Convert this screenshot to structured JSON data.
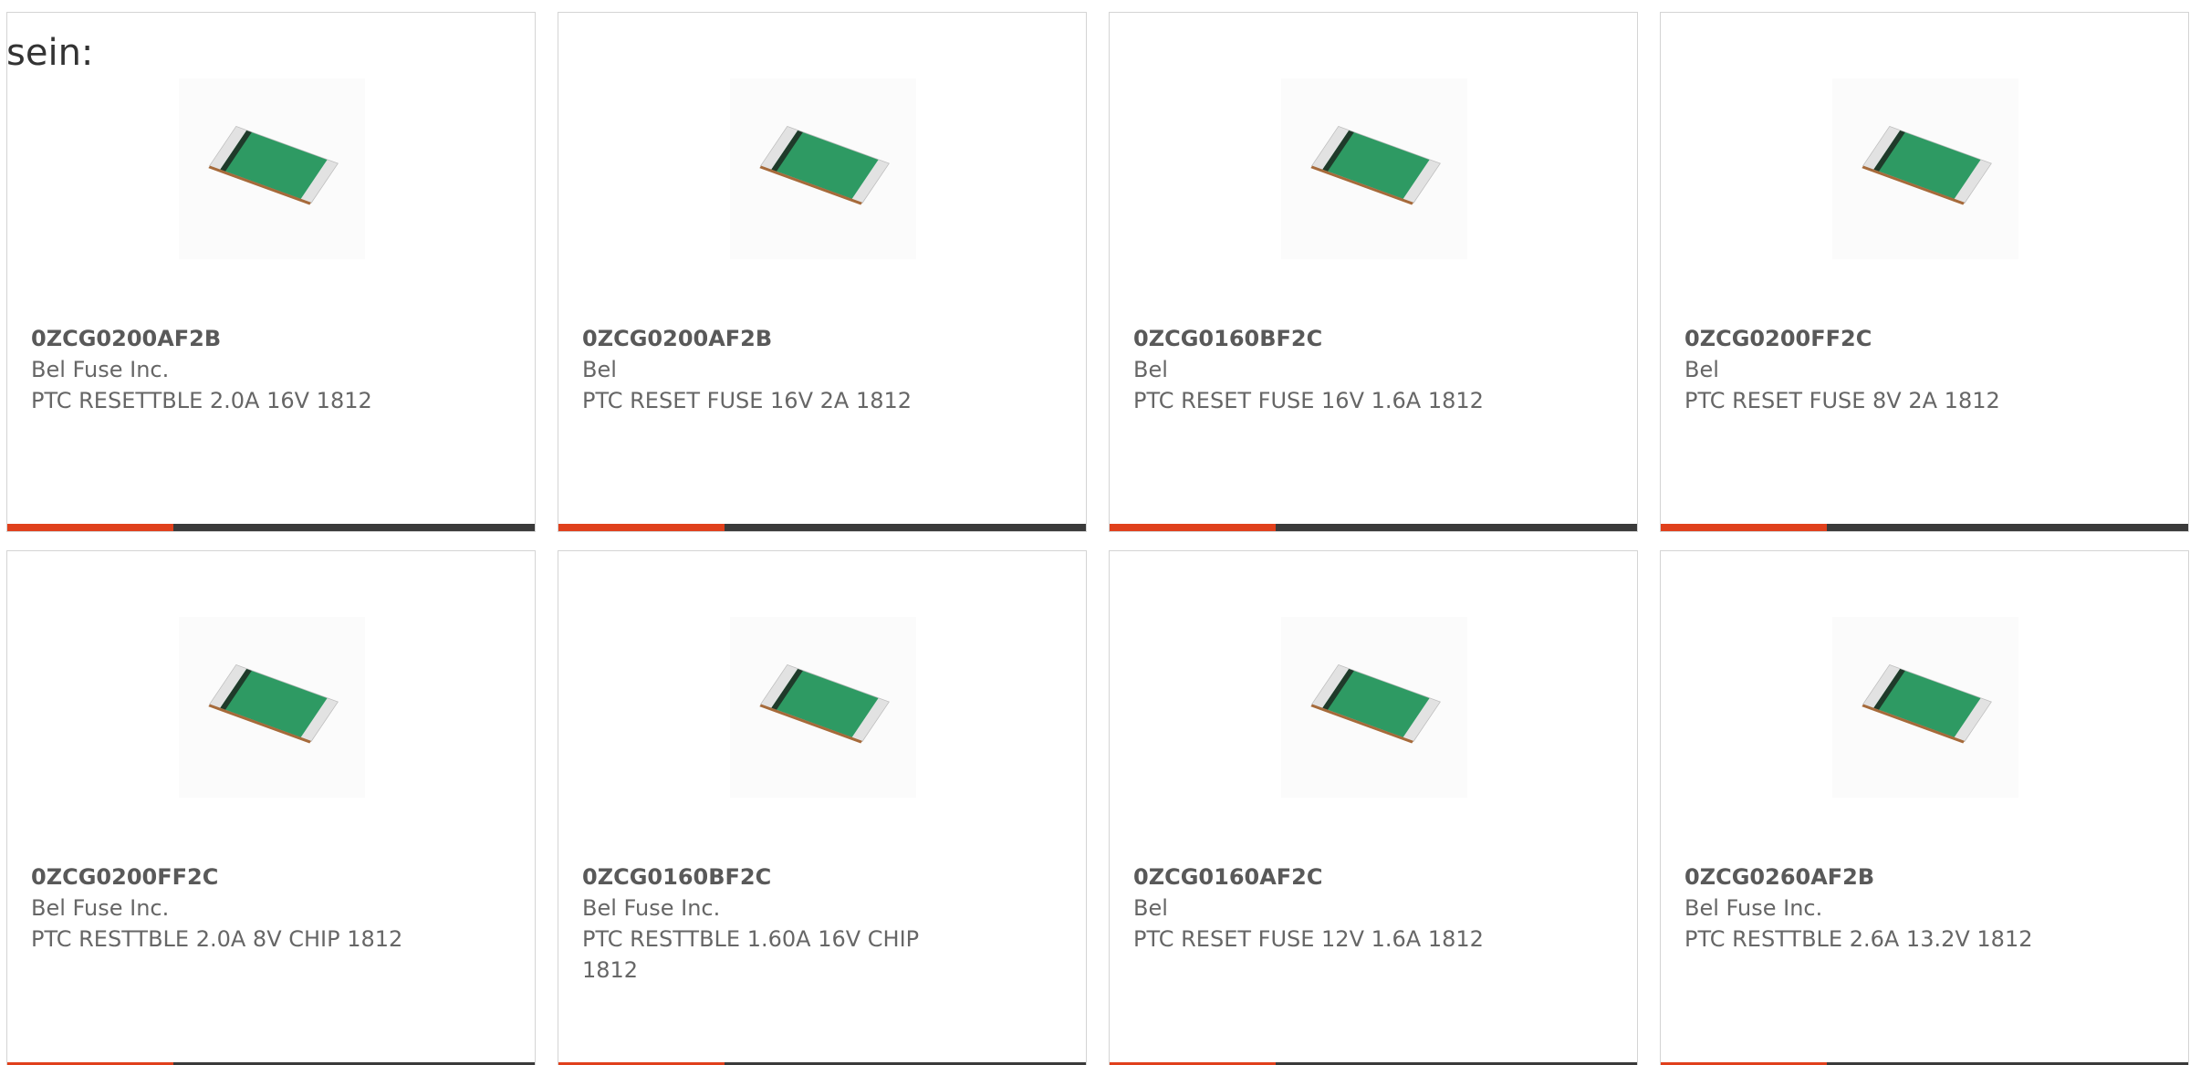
{
  "intro_text": "sein:",
  "colors": {
    "accent_bar": "#e0401c",
    "base_bar": "#3a3a3a",
    "chip_green": "#2e9a63"
  },
  "products": [
    {
      "part": "0ZCG0200AF2B",
      "manufacturer": "Bel Fuse Inc.",
      "description": "PTC RESETTBLE 2.0A 16V 1812",
      "image_icon": "ptc-fuse-chip-image"
    },
    {
      "part": "0ZCG0200AF2B",
      "manufacturer": "Bel",
      "description": "PTC RESET FUSE 16V 2A 1812",
      "image_icon": "ptc-fuse-chip-image"
    },
    {
      "part": "0ZCG0160BF2C",
      "manufacturer": "Bel",
      "description": "PTC RESET FUSE 16V 1.6A 1812",
      "image_icon": "ptc-fuse-chip-image"
    },
    {
      "part": "0ZCG0200FF2C",
      "manufacturer": "Bel",
      "description": "PTC RESET FUSE 8V 2A 1812",
      "image_icon": "ptc-fuse-chip-image"
    },
    {
      "part": "0ZCG0200FF2C",
      "manufacturer": "Bel Fuse Inc.",
      "description": "PTC RESTTBLE 2.0A 8V CHIP 1812",
      "image_icon": "ptc-fuse-chip-image"
    },
    {
      "part": "0ZCG0160BF2C",
      "manufacturer": "Bel Fuse Inc.",
      "description": "PTC RESTTBLE 1.60A 16V CHIP 1812",
      "image_icon": "ptc-fuse-chip-image"
    },
    {
      "part": "0ZCG0160AF2C",
      "manufacturer": "Bel",
      "description": "PTC RESET FUSE 12V 1.6A 1812",
      "image_icon": "ptc-fuse-chip-image"
    },
    {
      "part": "0ZCG0260AF2B",
      "manufacturer": "Bel Fuse Inc.",
      "description": "PTC RESTTBLE 2.6A 13.2V 1812",
      "image_icon": "ptc-fuse-chip-image"
    }
  ]
}
